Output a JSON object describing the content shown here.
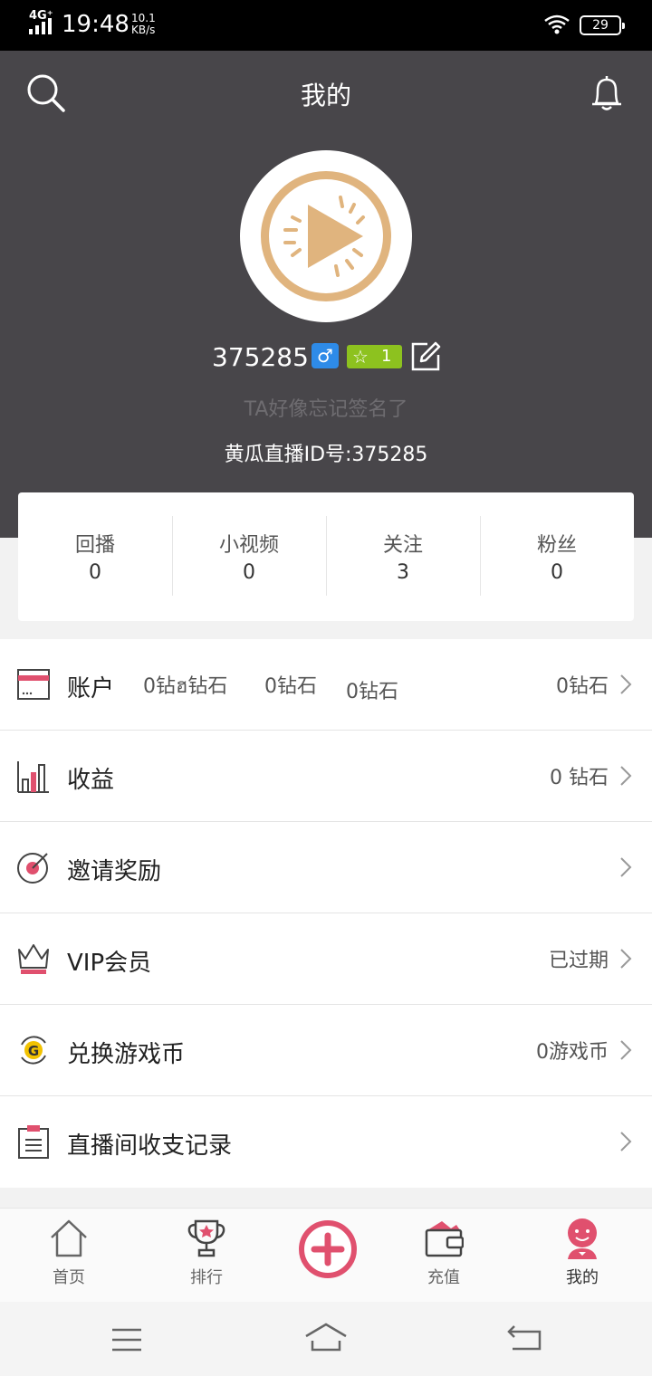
{
  "status_bar": {
    "network": "4G⁺",
    "time": "19:48",
    "speed_value": "10.1",
    "speed_unit": "KB/s",
    "battery": "29"
  },
  "header": {
    "title": "我的"
  },
  "profile": {
    "user_number": "375285",
    "gender_symbol": "♂",
    "level": "1",
    "signature": "TA好像忘记签名了",
    "platform_id": "黄瓜直播ID号:375285"
  },
  "stats": [
    {
      "label": "回播",
      "value": "0"
    },
    {
      "label": "小视频",
      "value": "0"
    },
    {
      "label": "关注",
      "value": "3"
    },
    {
      "label": "粉丝",
      "value": "0"
    }
  ],
  "menu": {
    "account": {
      "label": "账户",
      "value": "0钻石",
      "extra_1": "0钻ฮ钻石",
      "extra_2": "0钻石",
      "extra_3": "0钻石"
    },
    "earnings": {
      "label": "收益",
      "value": "0 钻石"
    },
    "invite": {
      "label": "邀请奖励",
      "value": ""
    },
    "vip": {
      "label": "VIP会员",
      "value": "已过期"
    },
    "exchange": {
      "label": "兑换游戏币",
      "value": "0游戏币"
    },
    "records": {
      "label": "直播间收支记录",
      "value": ""
    }
  },
  "tabs": {
    "home": "首页",
    "rank": "排行",
    "recharge": "充值",
    "mine": "我的"
  },
  "colors": {
    "header_bg": "#48464a",
    "accent": "#e0506e",
    "logo": "#e0b47e"
  }
}
